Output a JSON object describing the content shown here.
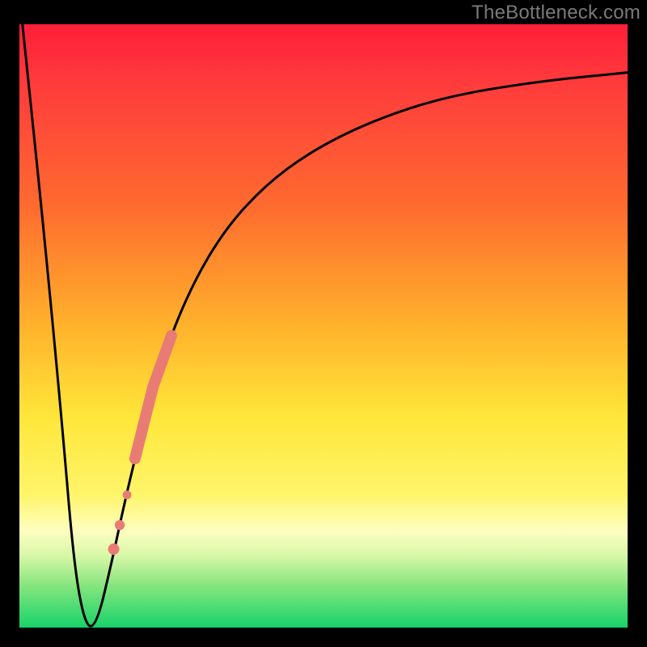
{
  "watermark": "TheBottleneck.com",
  "chart_data": {
    "type": "line",
    "title": "",
    "xlabel": "",
    "ylabel": "",
    "xlim": [
      0,
      100
    ],
    "ylim": [
      0,
      100
    ],
    "grid": false,
    "legend": false,
    "series": [
      {
        "name": "bottleneck-curve",
        "x": [
          0.5,
          4,
          7,
          9,
          10.9,
          12.7,
          15,
          18,
          22,
          27,
          33,
          40,
          48,
          58,
          70,
          85,
          100
        ],
        "y": [
          100,
          66,
          34,
          10,
          0,
          0.5,
          10,
          24,
          40,
          54,
          65,
          73,
          79,
          84,
          88,
          90.5,
          92
        ],
        "color": "#000000",
        "stroke_width": 2
      }
    ],
    "highlight_points": {
      "name": "highlight-dots",
      "color": "#e87c74",
      "points": [
        {
          "x": 15.5,
          "y": 13
        },
        {
          "x": 16.5,
          "y": 17
        },
        {
          "x": 17.7,
          "y": 22
        },
        {
          "x": 19.5,
          "y": 30
        },
        {
          "x": 21.0,
          "y": 36
        },
        {
          "x": 22.5,
          "y": 42
        }
      ]
    },
    "background_gradient": {
      "top": "#ff1f3a",
      "mid": "#ffe63a",
      "bottom": "#17d36a"
    },
    "source_label": "TheBottleneck.com"
  }
}
